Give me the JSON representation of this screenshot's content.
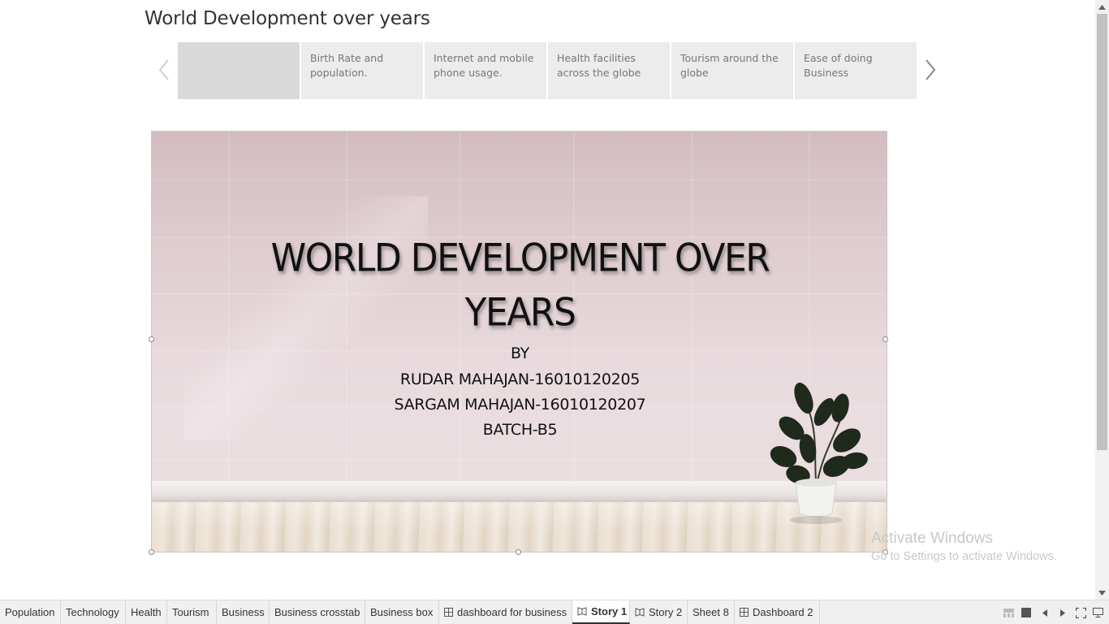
{
  "story": {
    "title": "World Development over years",
    "points": [
      {
        "label": ""
      },
      {
        "label": "Birth Rate and population."
      },
      {
        "label": "Internet and mobile phone usage."
      },
      {
        "label": "Health facilities across the globe"
      },
      {
        "label": "Tourism around the globe"
      },
      {
        "label": "Ease of doing Business"
      }
    ]
  },
  "slide": {
    "heading_line1": "WORLD DEVELOPMENT OVER",
    "heading_line2": "YEARS",
    "by": "BY",
    "author1": "RUDAR MAHAJAN-16010120205",
    "author2": "SARGAM MAHAJAN-16010120207",
    "batch": "BATCH-B5"
  },
  "watermark": {
    "line1": "Activate Windows",
    "line2": "Go to Settings to activate Windows."
  },
  "tabs": [
    {
      "label": "Population",
      "icon": ""
    },
    {
      "label": "Technology",
      "icon": ""
    },
    {
      "label": "Health",
      "icon": ""
    },
    {
      "label": "Tourism",
      "icon": ""
    },
    {
      "label": "Business",
      "icon": ""
    },
    {
      "label": "Business crosstab",
      "icon": ""
    },
    {
      "label": "Business box",
      "icon": ""
    },
    {
      "label": "dashboard for business",
      "icon": "dashboard-icon"
    },
    {
      "label": "Story 1",
      "icon": "story-icon"
    },
    {
      "label": "Story 2",
      "icon": "story-icon"
    },
    {
      "label": "Sheet 8",
      "icon": ""
    },
    {
      "label": "Dashboard 2",
      "icon": "dashboard-icon"
    }
  ],
  "colors": {
    "active_point": "#d9d9d9",
    "point": "#ececec",
    "slide_wall": "#e5d5d8"
  }
}
